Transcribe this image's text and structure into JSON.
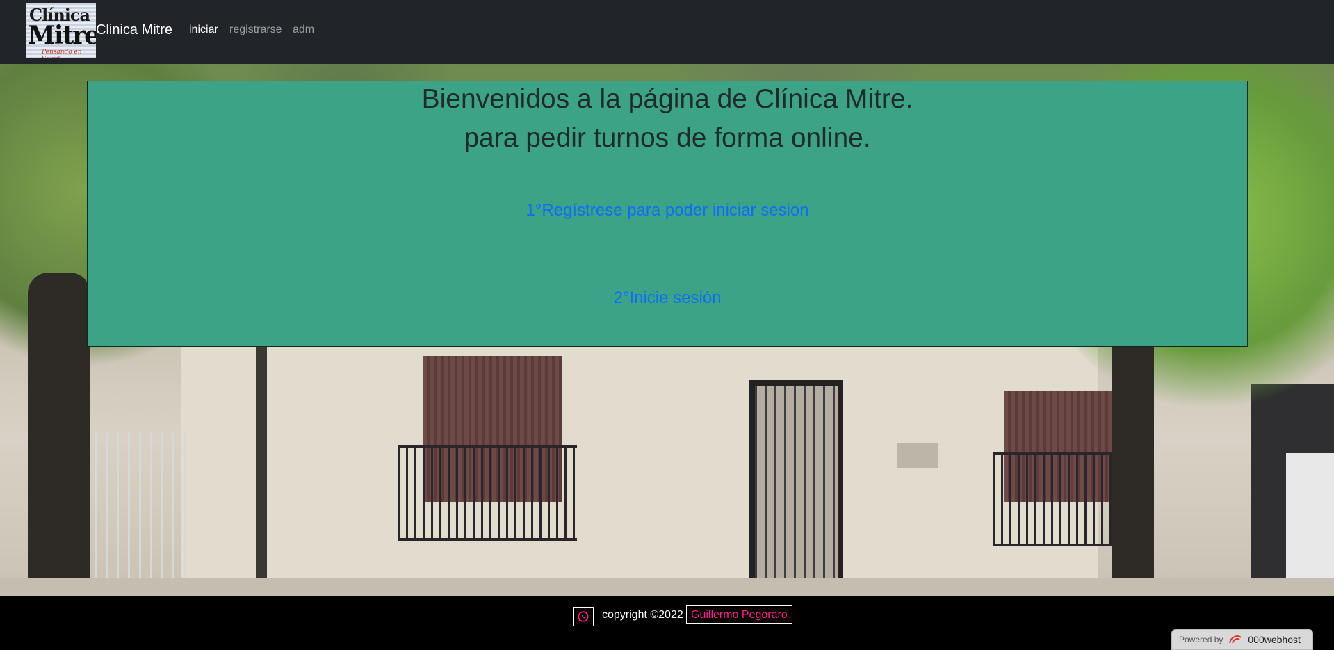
{
  "navbar": {
    "logo_text_top": "Clínica",
    "logo_text_main": "Mitre",
    "logo_text_tagline": "Pensando en Salud",
    "brand": "Clinica Mitre",
    "links": [
      {
        "label": "iniciar",
        "active": true
      },
      {
        "label": "registrarse",
        "active": false
      },
      {
        "label": "adm",
        "active": false
      }
    ]
  },
  "card": {
    "heading_line1": "Bienvenidos a la página de Clínica Mitre.",
    "heading_line2": "para pedir turnos de forma online.",
    "step1_link": "1°Regístrese para poder iniciar sesion",
    "step2_link": "2°Inicie sesión",
    "background_color": "#3da386",
    "link_color": "#0d6efd"
  },
  "footer": {
    "whatsapp_icon": "whatsapp-icon",
    "copyright": "copyright ©2022",
    "author": "Guillermo Pegoraro",
    "author_color": "#ff1e8e",
    "powered_by": "Powered by",
    "host": "000webhost"
  }
}
